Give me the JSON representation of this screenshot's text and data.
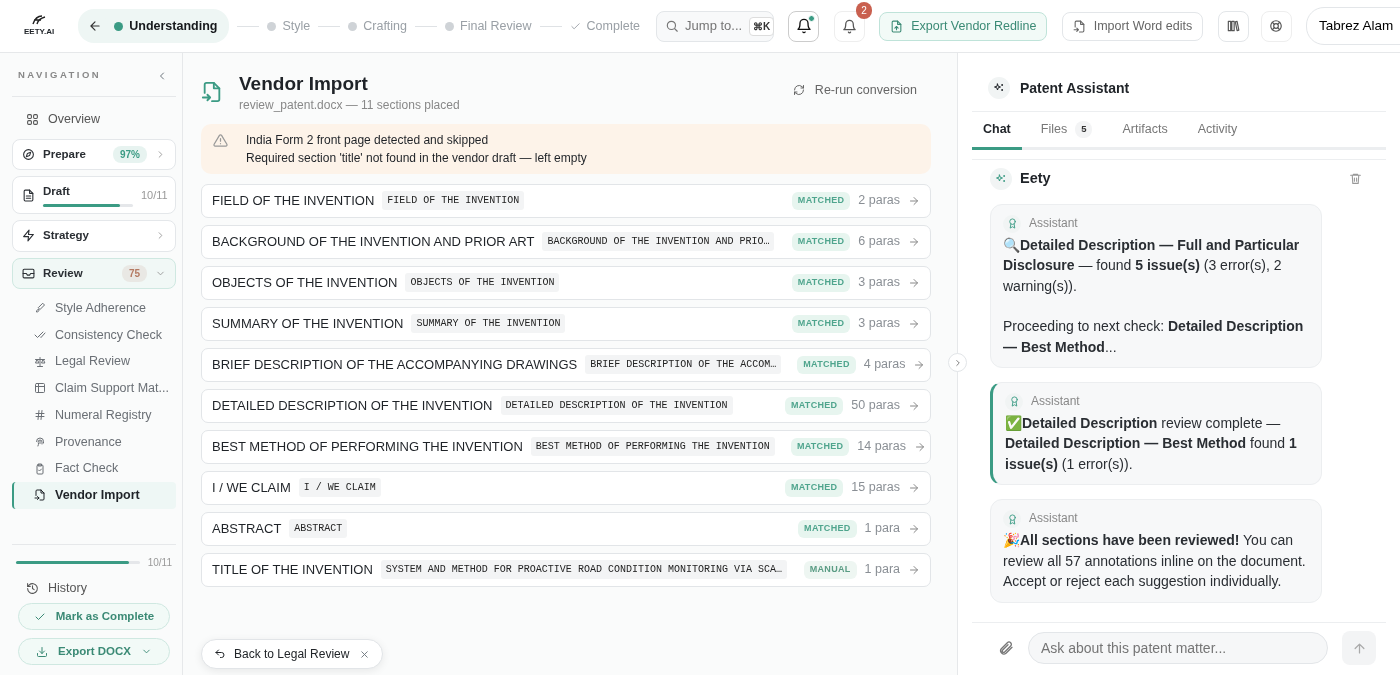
{
  "header": {
    "logo_text": "EETY.AI",
    "steps": [
      {
        "label": "Understanding",
        "kind": "current"
      },
      {
        "label": "Style",
        "kind": "pending"
      },
      {
        "label": "Crafting",
        "kind": "pending"
      },
      {
        "label": "Final Review",
        "kind": "pending"
      },
      {
        "label": "Complete",
        "kind": "final"
      }
    ],
    "search": {
      "placeholder": "Jump to...",
      "shortcut": "⌘K"
    },
    "notifications": {
      "has_dot": true
    },
    "alerts": {
      "badge": "2"
    },
    "buttons": [
      {
        "label": "Export Vendor Redline",
        "kind": "primary"
      },
      {
        "label": "Import Word edits",
        "kind": "secondary"
      }
    ],
    "user": {
      "name": "Tabrez Alam"
    }
  },
  "sidebar": {
    "title": "NAVIGATION",
    "items": [
      {
        "kind": "link",
        "label": "Overview"
      },
      {
        "kind": "group",
        "label": "Prepare",
        "badge": "97%",
        "color": "#3b9b84",
        "expanded": false
      },
      {
        "kind": "group",
        "label": "Draft",
        "count": "10/11",
        "level": 0.85,
        "expanded": false
      },
      {
        "kind": "group",
        "label": "Strategy",
        "expanded": false
      },
      {
        "kind": "group",
        "label": "Review",
        "badge": "75",
        "color": "#b47a62",
        "expanded": true,
        "children": [
          {
            "label": "Style Adherence",
            "selected": false
          },
          {
            "label": "Consistency Check",
            "selected": false
          },
          {
            "label": "Legal Review",
            "selected": false
          },
          {
            "label": "Claim Support Mat...",
            "selected": false
          },
          {
            "label": "Numeral Registry",
            "selected": false
          },
          {
            "label": "Provenance",
            "selected": false
          },
          {
            "label": "Fact Check",
            "selected": false
          },
          {
            "label": "Vendor Import",
            "selected": true
          }
        ]
      }
    ],
    "progress": {
      "level": 0.91,
      "count": "10/11"
    },
    "history": "History",
    "complete_button": "Mark as Complete",
    "export_button": "Export DOCX"
  },
  "main": {
    "title": "Vendor Import",
    "subtitle": "review_patent.docx — 11 sections placed",
    "rerun": "Re-run conversion",
    "warnings": [
      "India Form 2 front page detected and skipped",
      "Required section 'title' not found in the vendor draft — left empty"
    ],
    "sections": [
      {
        "heading": "FIELD OF THE INVENTION",
        "source": "FIELD OF THE INVENTION",
        "status": "MATCHED",
        "kind": "matched",
        "count": "2 paras"
      },
      {
        "heading": "BACKGROUND OF THE INVENTION AND PRIOR ART",
        "source": "BACKGROUND OF THE INVENTION AND PRIO…",
        "status": "MATCHED",
        "kind": "matched",
        "count": "6 paras"
      },
      {
        "heading": "OBJECTS OF THE INVENTION",
        "source": "OBJECTS OF THE INVENTION",
        "status": "MATCHED",
        "kind": "matched",
        "count": "3 paras"
      },
      {
        "heading": "SUMMARY OF THE INVENTION",
        "source": "SUMMARY OF THE INVENTION",
        "status": "MATCHED",
        "kind": "matched",
        "count": "3 paras"
      },
      {
        "heading": "BRIEF DESCRIPTION OF THE ACCOMPANYING DRAWINGS",
        "source": "BRIEF DESCRIPTION OF THE ACCOM…",
        "status": "MATCHED",
        "kind": "matched",
        "count": "4 paras"
      },
      {
        "heading": "DETAILED DESCRIPTION OF THE INVENTION",
        "source": "DETAILED DESCRIPTION OF THE INVENTION",
        "status": "MATCHED",
        "kind": "matched",
        "count": "50 paras"
      },
      {
        "heading": "BEST METHOD OF PERFORMING THE INVENTION",
        "source": "BEST METHOD OF PERFORMING THE INVENTION",
        "status": "MATCHED",
        "kind": "matched",
        "count": "14 paras"
      },
      {
        "heading": "I / WE CLAIM",
        "source": "I / WE CLAIM",
        "status": "MATCHED",
        "kind": "matched",
        "count": "15 paras"
      },
      {
        "heading": "ABSTRACT",
        "source": "ABSTRACT",
        "status": "MATCHED",
        "kind": "matched",
        "count": "1 para"
      },
      {
        "heading": "TITLE OF THE INVENTION",
        "source": "SYSTEM AND METHOD FOR PROACTIVE ROAD CONDITION MONITORING VIA SCA…",
        "status": "MANUAL",
        "kind": "manual",
        "count": "1 para"
      }
    ],
    "toast": "Back to Legal Review"
  },
  "assistant": {
    "title": "Patent Assistant",
    "tabs": [
      {
        "label": "Chat",
        "selected": true
      },
      {
        "label": "Files",
        "count": "5",
        "selected": false
      },
      {
        "label": "Artifacts",
        "selected": false
      },
      {
        "label": "Activity",
        "selected": false
      }
    ],
    "chat_title": "Eety",
    "messages": [
      {
        "role": "Assistant",
        "highlighted": false,
        "paragraphs": [
          "🔍**Detailed Description — Full and Particular Disclosure** — found **5 issue(s)** (3 error(s), 2 warning(s)).",
          "Proceeding to next check: **Detailed Description — Best Method**..."
        ]
      },
      {
        "role": "Assistant",
        "highlighted": true,
        "paragraphs": [
          "✅**Detailed Description** review complete — **Detailed Description — Best Method** found **1 issue(s)** (1 error(s))."
        ]
      },
      {
        "role": "Assistant",
        "highlighted": false,
        "paragraphs": [
          "🎉**All sections have been reviewed!** You can review all 57 annotations inline on the document. Accept or reject each suggestion individually."
        ]
      }
    ],
    "input_placeholder": "Ask about this patent matter..."
  }
}
